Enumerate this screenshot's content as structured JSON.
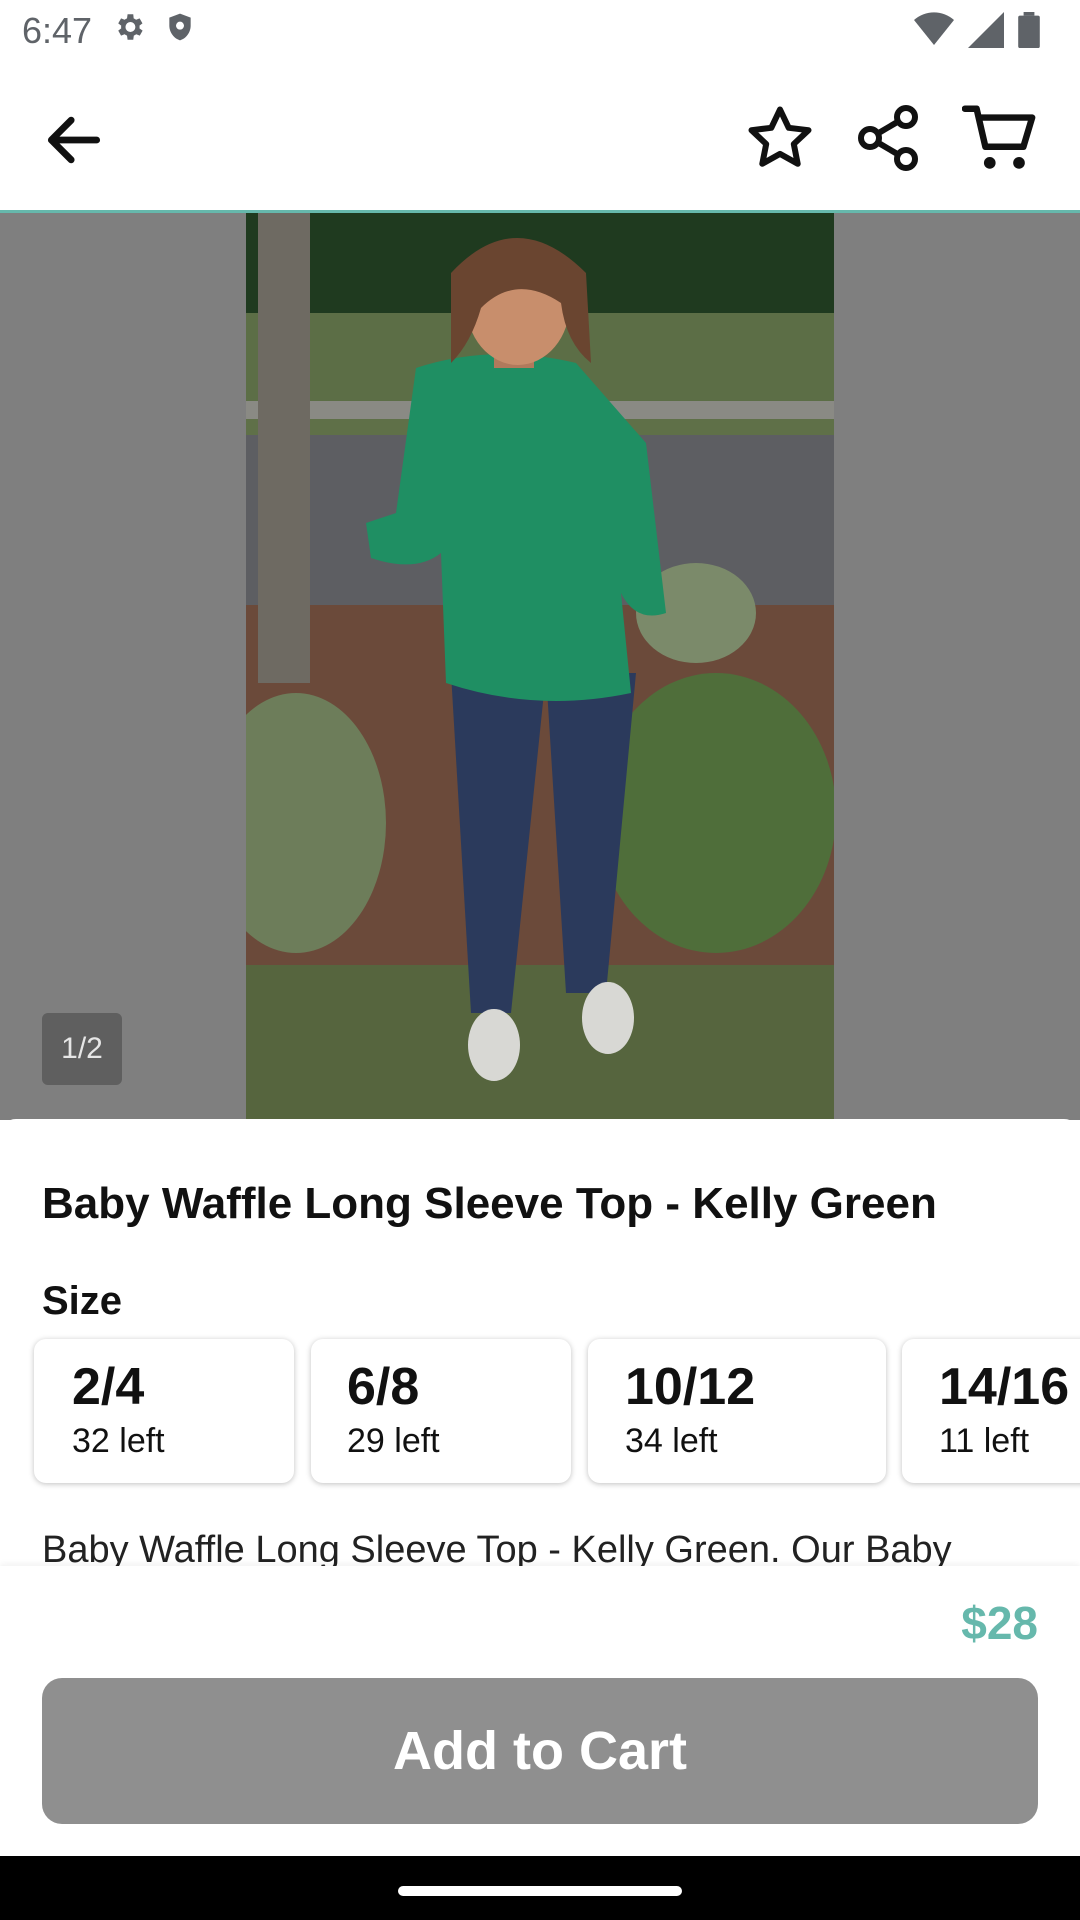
{
  "status_bar": {
    "time": "6:47",
    "icons_left": [
      "gear-icon",
      "shield-icon"
    ],
    "icons_right": [
      "wifi-icon",
      "cell-signal-icon",
      "battery-icon"
    ]
  },
  "app_bar": {
    "icons": [
      "back-arrow-icon",
      "star-icon",
      "share-icon",
      "cart-icon"
    ],
    "accent_color": "#66b8ac"
  },
  "gallery": {
    "counter": "1/2"
  },
  "product": {
    "title": "Baby Waffle Long Sleeve Top - Kelly Green",
    "size_label": "Size",
    "sizes": [
      {
        "name": "2/4",
        "stock": "32 left"
      },
      {
        "name": "6/8",
        "stock": "29 left"
      },
      {
        "name": "10/12",
        "stock": "34 left"
      },
      {
        "name": "14/16",
        "stock": "11 left"
      }
    ],
    "description": "Baby Waffle Long Sleeve Top - Kelly Green. Our Baby"
  },
  "footer": {
    "price": "$28",
    "add_to_cart_label": "Add to Cart",
    "price_color": "#66b8ac"
  }
}
